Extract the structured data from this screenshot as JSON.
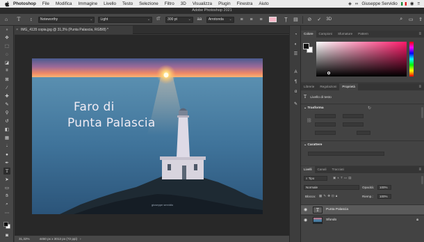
{
  "menubar": {
    "app_name": "Photoshop",
    "items": [
      "File",
      "Modifica",
      "Immagine",
      "Livello",
      "Testo",
      "Selezione",
      "Filtro",
      "3D",
      "Visualizza",
      "Plugin",
      "Finestra",
      "Aiuto"
    ],
    "user": "Giuseppe Servidio"
  },
  "window": {
    "title": "Adobe Photoshop 2021"
  },
  "options": {
    "font_family": "Noteworthy",
    "font_style": "Light",
    "font_size": "300 pt",
    "antialias": "Arrotonda",
    "text_color": "#f4b6c6"
  },
  "document": {
    "tab_label": "IMG_4135 copia.jpg @ 31,3% (Punta Palascia, RGB/8) *",
    "photo_text_line1": "Faro di",
    "photo_text_line2": "Punta Palascia",
    "watermark": "giuseppe servidio"
  },
  "status": {
    "zoom": "31,32%",
    "doc_size": "4450 px x 3012 px (72 ppi)"
  },
  "color_panel": {
    "tabs": [
      "Colore",
      "Campioni",
      "Sfumature",
      "Pattern"
    ],
    "active_tab": "Colore",
    "foreground": "#111111",
    "background": "#ffffff",
    "hue_color": "#ff1a6a"
  },
  "properties_panel": {
    "tabs": [
      "Librerie",
      "Regolazioni",
      "Proprietà"
    ],
    "active_tab": "Proprietà",
    "layer_type": "Livello di testo",
    "transform_label": "Trasforma",
    "character_label": "Carattere"
  },
  "layers_panel": {
    "tabs": [
      "Livelli",
      "Canali",
      "Tracciati"
    ],
    "active_tab": "Livelli",
    "filter_label": "Tipo",
    "blend_mode": "Normale",
    "opacity_label": "Opacità:",
    "opacity_value": "100%",
    "lock_label": "Blocca:",
    "fill_label": "Riemp.:",
    "fill_value": "100%",
    "layers": [
      {
        "name": "Punta Palascia",
        "type": "text",
        "selected": true
      },
      {
        "name": "Sfondo",
        "type": "image",
        "selected": false
      }
    ]
  }
}
